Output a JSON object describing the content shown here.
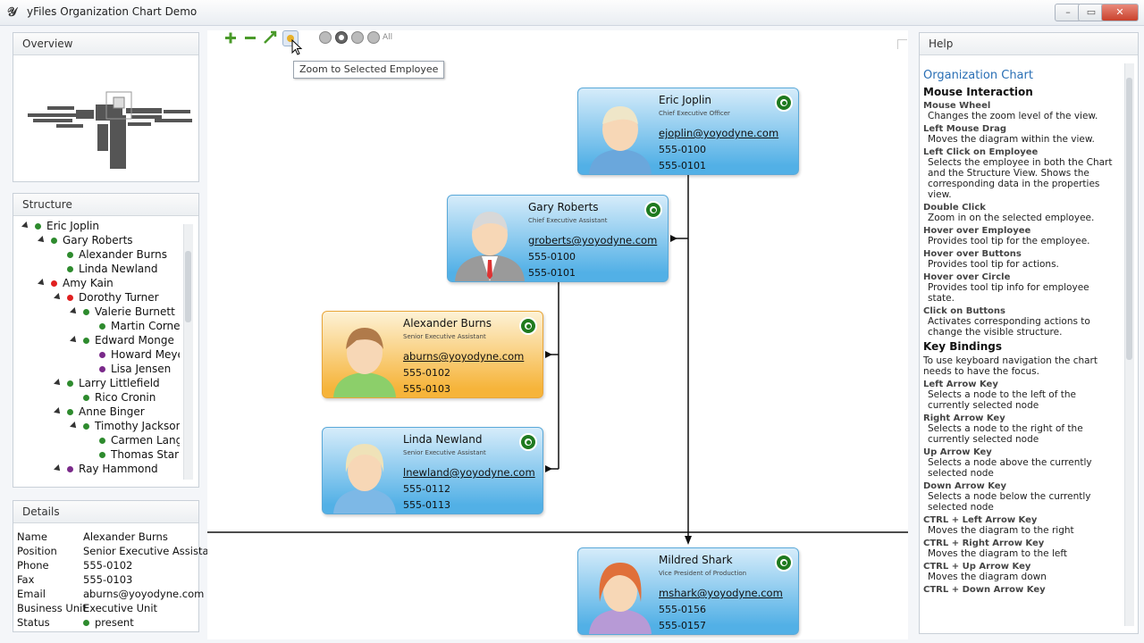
{
  "window": {
    "title": "yFiles Organization Chart Demo",
    "controls": [
      "minimize-icon",
      "maximize-icon",
      "close-icon"
    ]
  },
  "overview": {
    "title": "Overview"
  },
  "structure": {
    "title": "Structure",
    "items": [
      {
        "label": "Eric Joplin",
        "level": 0,
        "expander": true,
        "status": "green"
      },
      {
        "label": "Gary Roberts",
        "level": 1,
        "expander": true,
        "status": "green"
      },
      {
        "label": "Alexander Burns",
        "level": 2,
        "expander": false,
        "status": "green"
      },
      {
        "label": "Linda Newland",
        "level": 2,
        "expander": false,
        "status": "green"
      },
      {
        "label": "Amy Kain",
        "level": 1,
        "expander": true,
        "status": "red"
      },
      {
        "label": "Dorothy Turner",
        "level": 2,
        "expander": true,
        "status": "red"
      },
      {
        "label": "Valerie Burnett",
        "level": 3,
        "expander": true,
        "status": "green"
      },
      {
        "label": "Martin Cornet",
        "level": 4,
        "expander": false,
        "status": "green"
      },
      {
        "label": "Edward Monge",
        "level": 3,
        "expander": true,
        "status": "green"
      },
      {
        "label": "Howard Meye",
        "level": 4,
        "expander": false,
        "status": "purple"
      },
      {
        "label": "Lisa Jensen",
        "level": 4,
        "expander": false,
        "status": "purple"
      },
      {
        "label": "Larry Littlefield",
        "level": 2,
        "expander": true,
        "status": "green"
      },
      {
        "label": "Rico Cronin",
        "level": 3,
        "expander": false,
        "status": "green"
      },
      {
        "label": "Anne Binger",
        "level": 2,
        "expander": true,
        "status": "green"
      },
      {
        "label": "Timothy Jackson",
        "level": 3,
        "expander": true,
        "status": "green"
      },
      {
        "label": "Carmen Lang",
        "level": 4,
        "expander": false,
        "status": "green"
      },
      {
        "label": "Thomas Stark",
        "level": 4,
        "expander": false,
        "status": "green"
      },
      {
        "label": "Ray Hammond",
        "level": 2,
        "expander": true,
        "status": "purple"
      }
    ]
  },
  "details": {
    "title": "Details",
    "rows": [
      {
        "key": "Name",
        "value": "Alexander Burns"
      },
      {
        "key": "Position",
        "value": "Senior Executive Assistar"
      },
      {
        "key": "Phone",
        "value": "555-0102"
      },
      {
        "key": "Fax",
        "value": "555-0103"
      },
      {
        "key": "Email",
        "value": "aburns@yoyodyne.com"
      },
      {
        "key": "Business Unit",
        "value": "Executive Unit"
      },
      {
        "key": "Status",
        "value": "present"
      }
    ]
  },
  "toolbar": {
    "buttons": [
      "zoom-in-icon",
      "zoom-out-icon",
      "fit-content-icon",
      "zoom-to-selected-icon",
      "show-parent-icon",
      "show-children-icon",
      "hide-parent-icon",
      "hide-children-icon",
      "show-all-icon"
    ],
    "show_all_label": "All",
    "tooltip": "Zoom to Selected Employee"
  },
  "chart": {
    "cards": [
      {
        "name": "Eric Joplin",
        "position": "Chief Executive Officer",
        "email": "ejoplin@yoyodyne.com",
        "phone": "555-0100",
        "fax": "555-0101",
        "color": "blue",
        "avatar": "male-blond"
      },
      {
        "name": "Gary Roberts",
        "position": "Chief Executive Assistant",
        "email": "groberts@yoyodyne.com",
        "phone": "555-0100",
        "fax": "555-0101",
        "color": "blue",
        "avatar": "male-suit"
      },
      {
        "name": "Alexander Burns",
        "position": "Senior Executive Assistant",
        "email": "aburns@yoyodyne.com",
        "phone": "555-0102",
        "fax": "555-0103",
        "color": "orange",
        "avatar": "male-brown"
      },
      {
        "name": "Linda Newland",
        "position": "Senior Executive Assistant",
        "email": "lnewland@yoyodyne.com",
        "phone": "555-0112",
        "fax": "555-0113",
        "color": "blue",
        "avatar": "female-blond"
      },
      {
        "name": "Mildred Shark",
        "position": "Vice President of Production",
        "email": "mshark@yoyodyne.com",
        "phone": "555-0156",
        "fax": "555-0157",
        "color": "blue",
        "avatar": "female-red"
      }
    ]
  },
  "help": {
    "title": "Help",
    "heading": "Organization Chart",
    "sections": [
      {
        "title": "Mouse Interaction",
        "intro": "",
        "items": [
          {
            "t": "Mouse Wheel",
            "d": "Changes the zoom level of the view."
          },
          {
            "t": "Left Mouse Drag",
            "d": "Moves the diagram within the view."
          },
          {
            "t": "Left Click on Employee",
            "d": "Selects the employee in both the Chart and the Structure View. Shows the corresponding data in the properties view."
          },
          {
            "t": "Double Click",
            "d": "Zoom in on the selected employee."
          },
          {
            "t": "Hover over Employee",
            "d": "Provides tool tip for the employee."
          },
          {
            "t": "Hover over Buttons",
            "d": "Provides tool tip for actions."
          },
          {
            "t": "Hover over Circle",
            "d": "Provides tool tip info for employee state."
          },
          {
            "t": "Click on Buttons",
            "d": "Activates corresponding actions to change the visible structure."
          }
        ]
      },
      {
        "title": "Key Bindings",
        "intro": "To use keyboard navigation the chart needs to have the focus.",
        "items": [
          {
            "t": "Left Arrow Key",
            "d": "Selects a node to the left of the currently selected node"
          },
          {
            "t": "Right Arrow Key",
            "d": "Selects a node to the right of the currently selected node"
          },
          {
            "t": "Up Arrow Key",
            "d": "Selects a node above the currently selected node"
          },
          {
            "t": "Down Arrow Key",
            "d": "Selects a node below the currently selected node"
          },
          {
            "t": "CTRL + Left Arrow Key",
            "d": "Moves the diagram to the right"
          },
          {
            "t": "CTRL + Right Arrow Key",
            "d": "Moves the diagram to the left"
          },
          {
            "t": "CTRL + Up Arrow Key",
            "d": "Moves the diagram down"
          },
          {
            "t": "CTRL + Down Arrow Key",
            "d": ""
          }
        ]
      }
    ]
  },
  "colors": {
    "status_green": "#2e8b2e",
    "status_red": "#e02020",
    "status_purple": "#7a2a8a",
    "help_heading": "#2a6fb5",
    "card_blue": "#52b0e6",
    "card_orange": "#f6b43a"
  }
}
